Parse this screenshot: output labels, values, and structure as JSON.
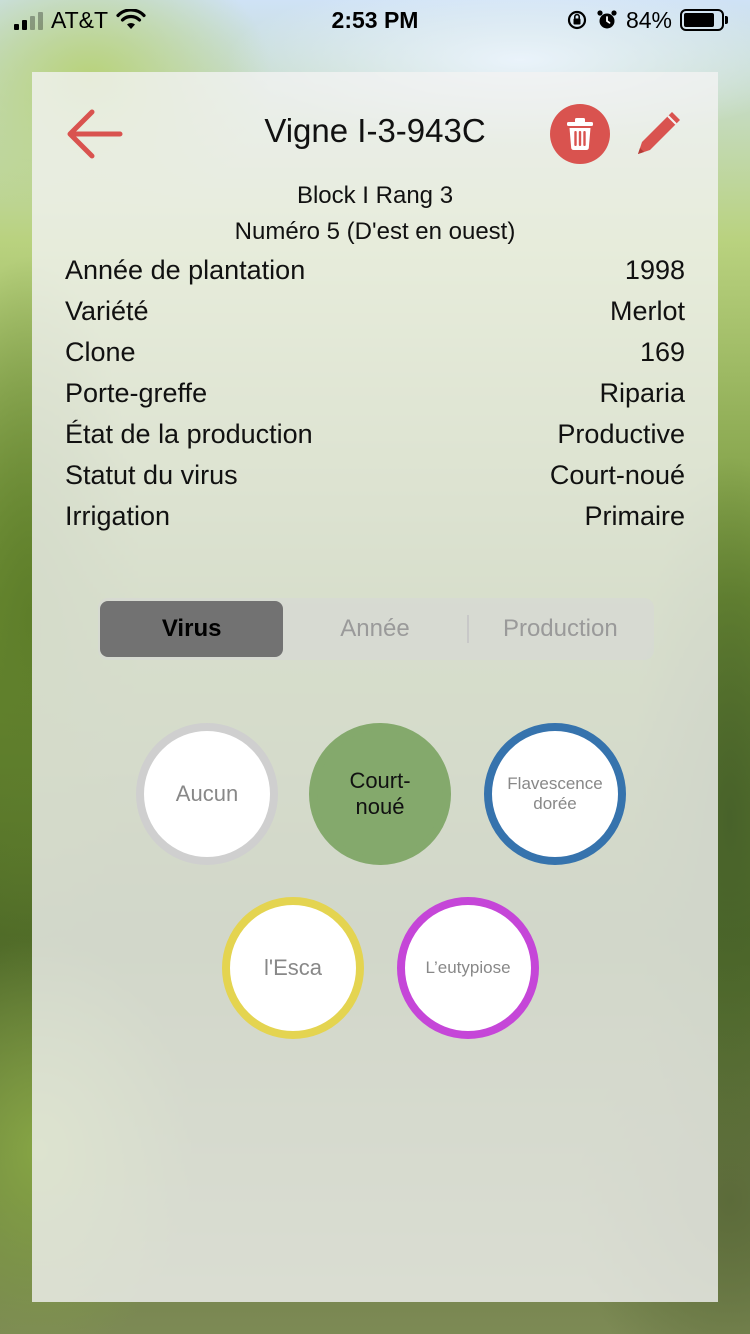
{
  "status_bar": {
    "carrier": "AT&T",
    "time": "2:53 PM",
    "battery_percent": "84%",
    "battery_level": 0.84
  },
  "header": {
    "title": "Vigne I-3-943C",
    "subtitle_line1": "Block I Rang 3",
    "subtitle_line2": "Numéro 5 (D'est en ouest)"
  },
  "info_rows": [
    {
      "label": "Année de plantation",
      "value": "1998"
    },
    {
      "label": "Variété",
      "value": "Merlot"
    },
    {
      "label": "Clone",
      "value": "169"
    },
    {
      "label": "Porte-greffe",
      "value": "Riparia"
    },
    {
      "label": "État de la production",
      "value": "Productive"
    },
    {
      "label": "Statut du virus",
      "value": "Court-noué"
    },
    {
      "label": "Irrigation",
      "value": "Primaire"
    }
  ],
  "tabs": [
    {
      "label": "Virus",
      "active": true
    },
    {
      "label": "Année",
      "active": false
    },
    {
      "label": "Production",
      "active": false
    }
  ],
  "virus_options": [
    {
      "label": "Aucun",
      "color": "#cfcfcf",
      "selected": false
    },
    {
      "label": "Court-noué",
      "color": "#84a96c",
      "selected": true
    },
    {
      "label": "Flavescence dorée",
      "color": "#3673ad",
      "selected": false
    },
    {
      "label": "l'Esca",
      "color": "#e4d450",
      "selected": false
    },
    {
      "label": "L’eutypiose",
      "color": "#c546d8",
      "selected": false
    }
  ],
  "icons": {
    "back": "arrow-left-icon",
    "delete": "trash-icon",
    "edit": "pencil-icon"
  },
  "colors": {
    "accent": "#d9534f"
  }
}
